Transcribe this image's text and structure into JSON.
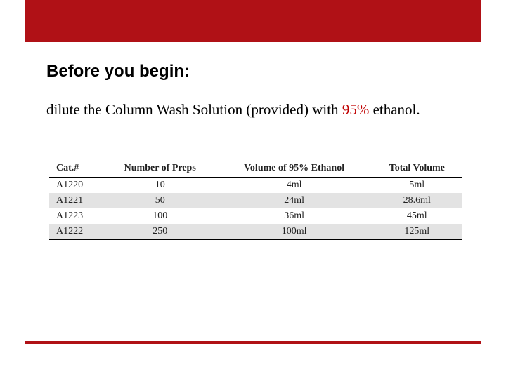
{
  "heading": "Before you begin:",
  "body": {
    "pre": "dilute the Column Wash Solution (provided) with ",
    "pct": "95%",
    "post": " ethanol."
  },
  "table": {
    "headers": [
      "Cat.#",
      "Number of Preps",
      "Volume of 95% Ethanol",
      "Total Volume"
    ],
    "rows": [
      {
        "shade": false,
        "cells": [
          "A1220",
          "10",
          "4ml",
          "5ml"
        ]
      },
      {
        "shade": true,
        "cells": [
          "A1221",
          "50",
          "24ml",
          "28.6ml"
        ]
      },
      {
        "shade": false,
        "cells": [
          "A1223",
          "100",
          "36ml",
          "45ml"
        ]
      },
      {
        "shade": true,
        "cells": [
          "A1222",
          "250",
          "100ml",
          "125ml"
        ]
      }
    ]
  }
}
